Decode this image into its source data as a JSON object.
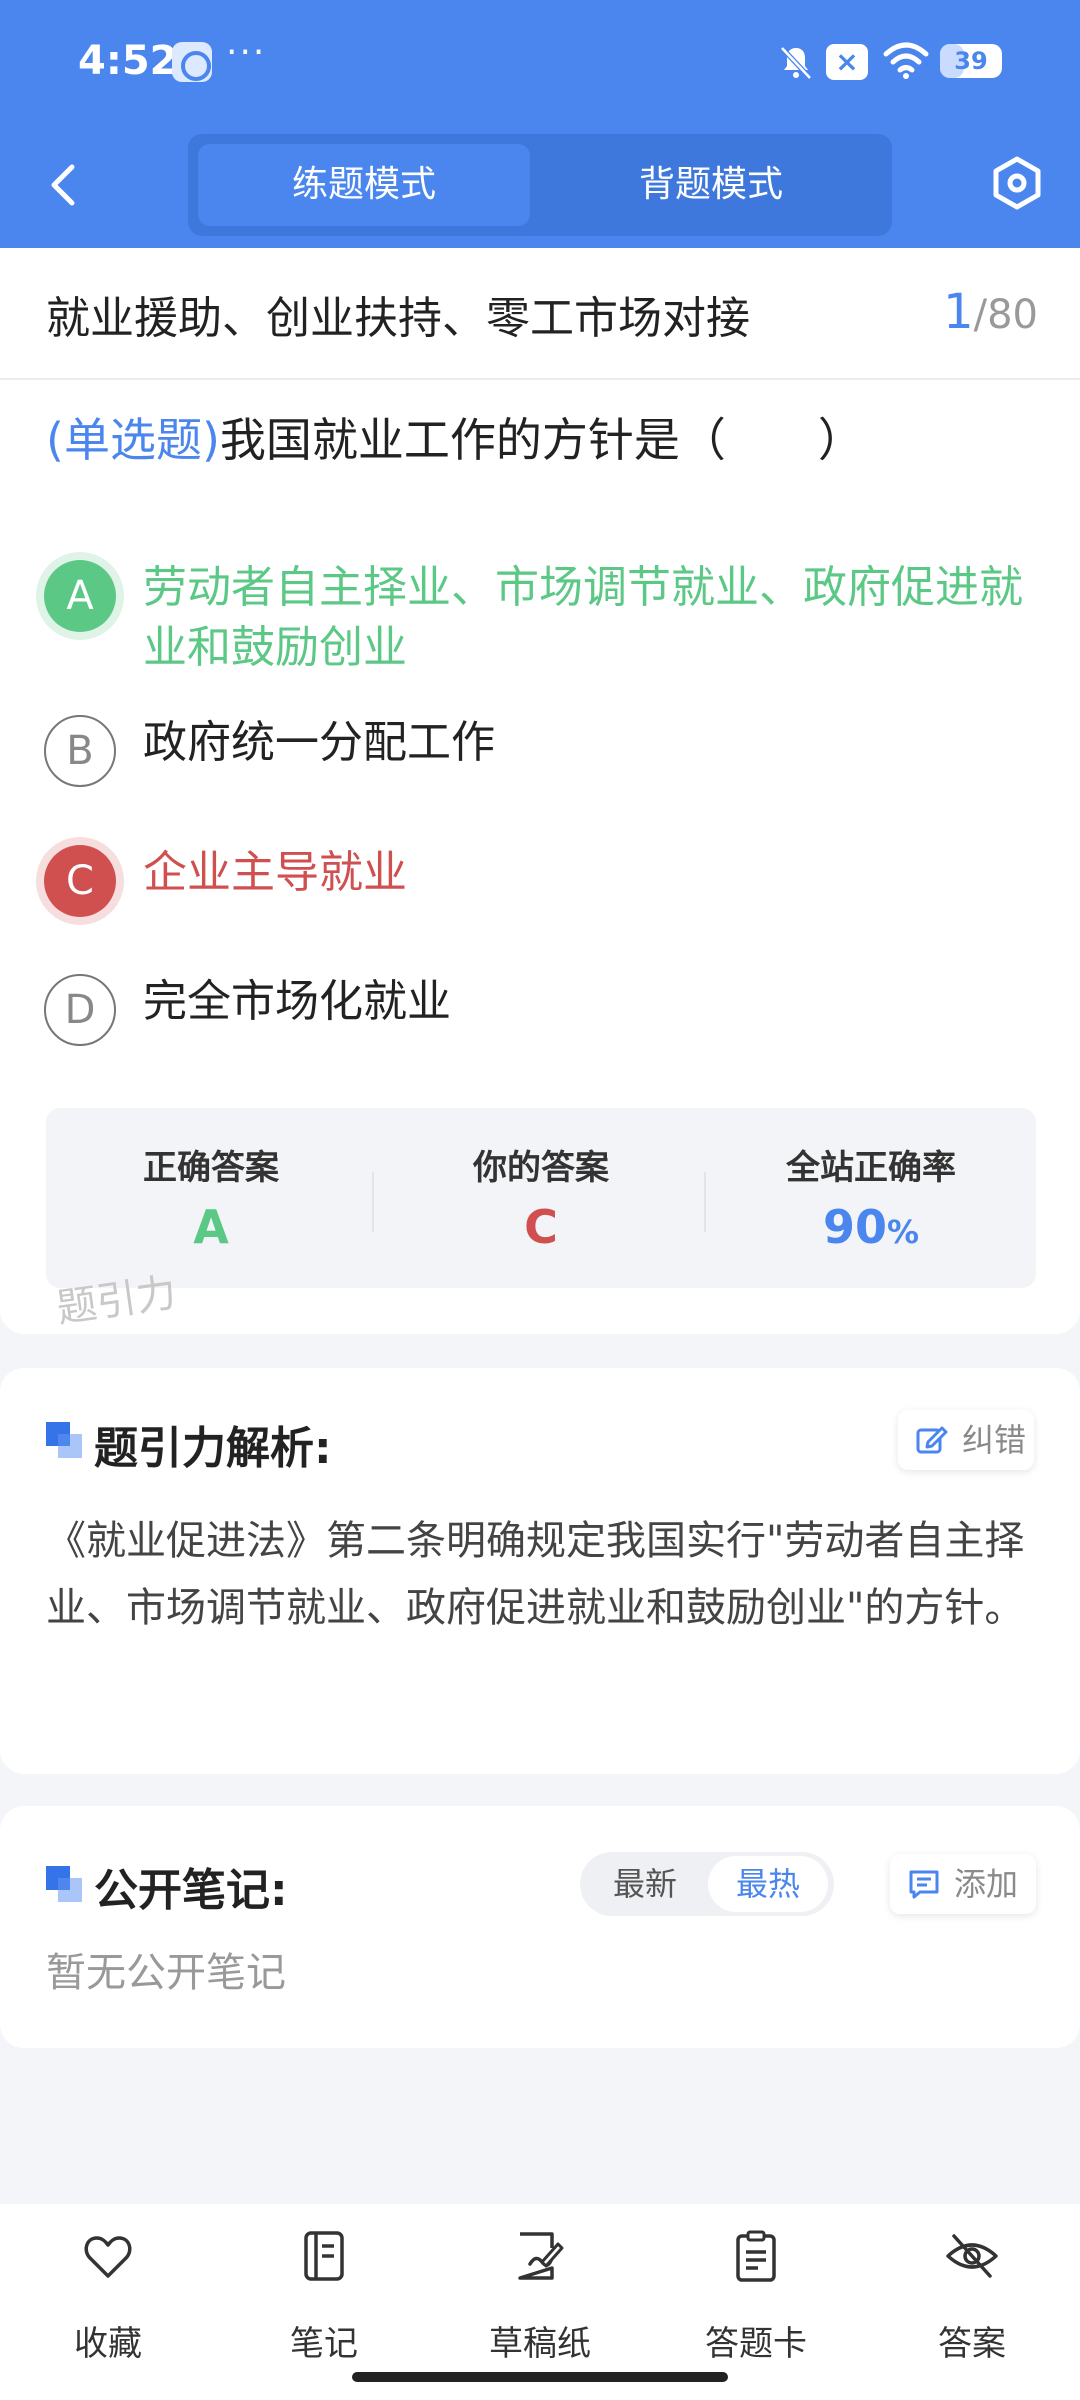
{
  "status_bar": {
    "time": "4:52",
    "dots": "···",
    "x_badge": "×",
    "battery": "39",
    "battery_fraction": 0.39
  },
  "header": {
    "modes": [
      "练题模式",
      "背题模式"
    ],
    "active_mode": 0
  },
  "section": {
    "title": "就业援助、创业扶持、零工市场对接",
    "current": "1",
    "total": "/80"
  },
  "question": {
    "type": "(单选题)",
    "text": "我国就业工作的方针是（　　）",
    "options": [
      {
        "key": "A",
        "text": "劳动者自主择业、市场调节就业、政府促进就业和鼓励创业",
        "state": "correct"
      },
      {
        "key": "B",
        "text": "政府统一分配工作",
        "state": "normal"
      },
      {
        "key": "C",
        "text": "企业主导就业",
        "state": "wrong"
      },
      {
        "key": "D",
        "text": "完全市场化就业",
        "state": "normal"
      }
    ]
  },
  "stats": {
    "correct_label": "正确答案",
    "correct_value": "A",
    "yours_label": "你的答案",
    "yours_value": "C",
    "rate_label": "全站正确率",
    "rate_value": "90",
    "rate_unit": "%"
  },
  "watermark": "题引力",
  "analysis": {
    "title": "题引力解析:",
    "report_label": "纠错",
    "text": "《就业促进法》第二条明确规定我国实行\"劳动者自主择业、市场调节就业、政府促进就业和鼓励创业\"的方针。"
  },
  "notes": {
    "title": "公开笔记:",
    "sort_options": [
      "最新",
      "最热"
    ],
    "active_sort": 1,
    "add_label": "添加",
    "empty_text": "暂无公开笔记"
  },
  "tabbar": {
    "items": [
      {
        "label": "收藏",
        "icon": "heart-icon"
      },
      {
        "label": "笔记",
        "icon": "notebook-icon"
      },
      {
        "label": "草稿纸",
        "icon": "draft-paper-icon"
      },
      {
        "label": "答题卡",
        "icon": "answer-sheet-icon"
      },
      {
        "label": "答案",
        "icon": "eye-off-icon"
      }
    ]
  },
  "colors": {
    "primary": "#4a86ee",
    "correct": "#5cc885",
    "wrong": "#d05050"
  }
}
